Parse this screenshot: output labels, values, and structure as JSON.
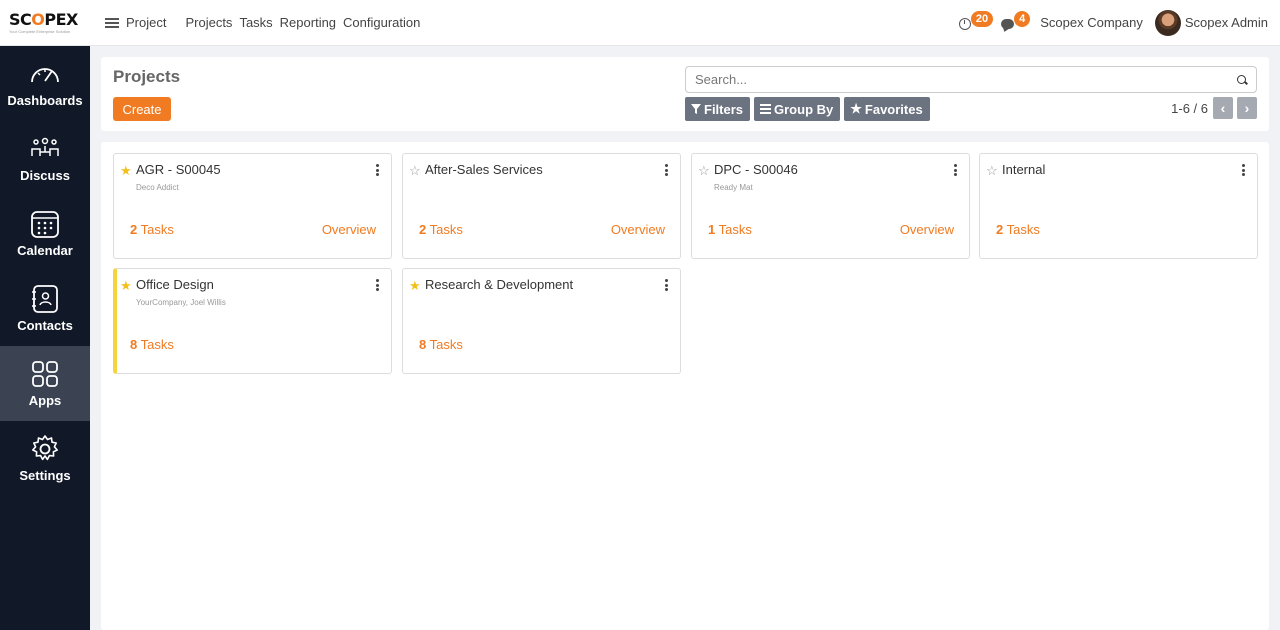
{
  "brand": {
    "logo_prefix": "SC",
    "logo_o": "O",
    "logo_suffix": "PEX",
    "tagline": "Your Complete Enterprise Solution",
    "accent": "#f07b22"
  },
  "topbar": {
    "app_name": "Project",
    "nav": [
      "Projects",
      "Tasks",
      "Reporting",
      "Configuration"
    ],
    "activity_count": "20",
    "message_count": "4",
    "company": "Scopex Company",
    "user": "Scopex Admin"
  },
  "sidebar": {
    "items": [
      {
        "label": "Dashboards",
        "icon": "speedometer-icon"
      },
      {
        "label": "Discuss",
        "icon": "people-icon"
      },
      {
        "label": "Calendar",
        "icon": "calendar-icon"
      },
      {
        "label": "Contacts",
        "icon": "contact-book-icon"
      },
      {
        "label": "Apps",
        "icon": "apps-grid-icon",
        "active": true
      },
      {
        "label": "Settings",
        "icon": "gear-icon"
      }
    ]
  },
  "control": {
    "title": "Projects",
    "create_label": "Create",
    "search_placeholder": "Search...",
    "filters_label": "Filters",
    "groupby_label": "Group By",
    "favorites_label": "Favorites",
    "pager": "1-6 / 6"
  },
  "projects": [
    {
      "name": "AGR - S00045",
      "customer": "Deco Addict",
      "task_count": "2",
      "tasks_word": "Tasks",
      "overview": "Overview",
      "favorite": true
    },
    {
      "name": "After-Sales Services",
      "customer": "",
      "task_count": "2",
      "tasks_word": "Tasks",
      "overview": "Overview",
      "favorite": false
    },
    {
      "name": "DPC - S00046",
      "customer": "Ready Mat",
      "task_count": "1",
      "tasks_word": "Tasks",
      "overview": "Overview",
      "favorite": false
    },
    {
      "name": "Internal",
      "customer": "",
      "task_count": "2",
      "tasks_word": "Tasks",
      "overview": "",
      "favorite": false
    },
    {
      "name": "Office Design",
      "customer": "YourCompany, Joel Willis",
      "task_count": "8",
      "tasks_word": "Tasks",
      "overview": "",
      "favorite": true,
      "color": "#f6d43c"
    },
    {
      "name": "Research & Development",
      "customer": "",
      "task_count": "8",
      "tasks_word": "Tasks",
      "overview": "",
      "favorite": true
    }
  ]
}
